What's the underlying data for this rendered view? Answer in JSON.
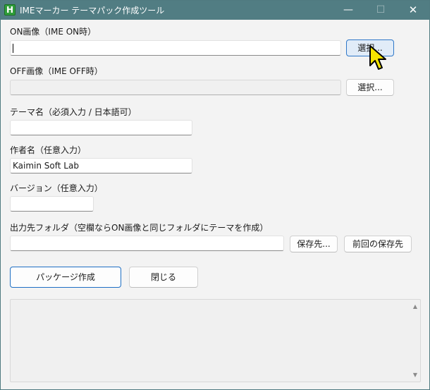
{
  "window": {
    "app_icon_letter": "H",
    "title": "IMEマーカー テーマパック作成ツール",
    "minimize_glyph": "—",
    "maximize_glyph": "☐",
    "close_glyph": "✕"
  },
  "on_image": {
    "label": "ON画像（IME ON時）",
    "value": "",
    "select_label": "選択..."
  },
  "off_image": {
    "label": "OFF画像（IME OFF時）",
    "value": "",
    "select_label": "選択..."
  },
  "theme_name": {
    "label": "テーマ名（必須入力 / 日本語可）",
    "value": ""
  },
  "author": {
    "label": "作者名（任意入力）",
    "value": "Kaimin Soft Lab"
  },
  "version": {
    "label": "バージョン（任意入力）",
    "value": ""
  },
  "output_folder": {
    "label": "出力先フォルダ（空欄ならON画像と同じフォルダにテーマを作成）",
    "value": "",
    "save_to_label": "保存先...",
    "last_save_label": "前回の保存先"
  },
  "actions": {
    "create_package_label": "パッケージ作成",
    "close_label": "閉じる"
  },
  "log": {
    "text": "",
    "scroll_up_glyph": "▲",
    "scroll_down_glyph": "▼"
  },
  "colors": {
    "titlebar": "#517d83",
    "accent": "#1e6fc4",
    "cursor_fill": "#f5e400"
  }
}
